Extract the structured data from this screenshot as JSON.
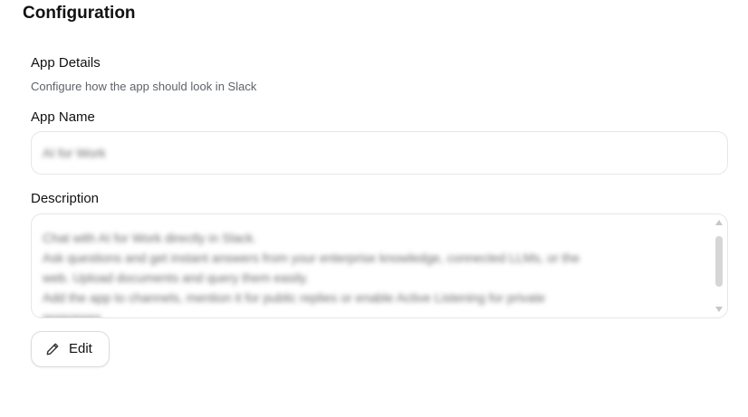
{
  "page": {
    "title": "Configuration"
  },
  "app_details": {
    "title": "App Details",
    "subtitle": "Configure how the app should look in Slack"
  },
  "app_name": {
    "label": "App Name",
    "value": "AI for Work"
  },
  "description": {
    "label": "Description",
    "lines": [
      "Chat with AI for Work directly in Slack.",
      "Ask questions and get instant answers from your enterprise knowledge, connected LLMs, or the",
      "web. Upload documents and query them easily.",
      "Add the app to channels, mention it for public replies or enable Active Listening for private",
      "responses."
    ]
  },
  "edit_button": {
    "label": "Edit",
    "icon": "pencil-icon"
  },
  "colors": {
    "border": "#e4e6ea",
    "muted_text": "#5f6368",
    "text": "#111111"
  }
}
